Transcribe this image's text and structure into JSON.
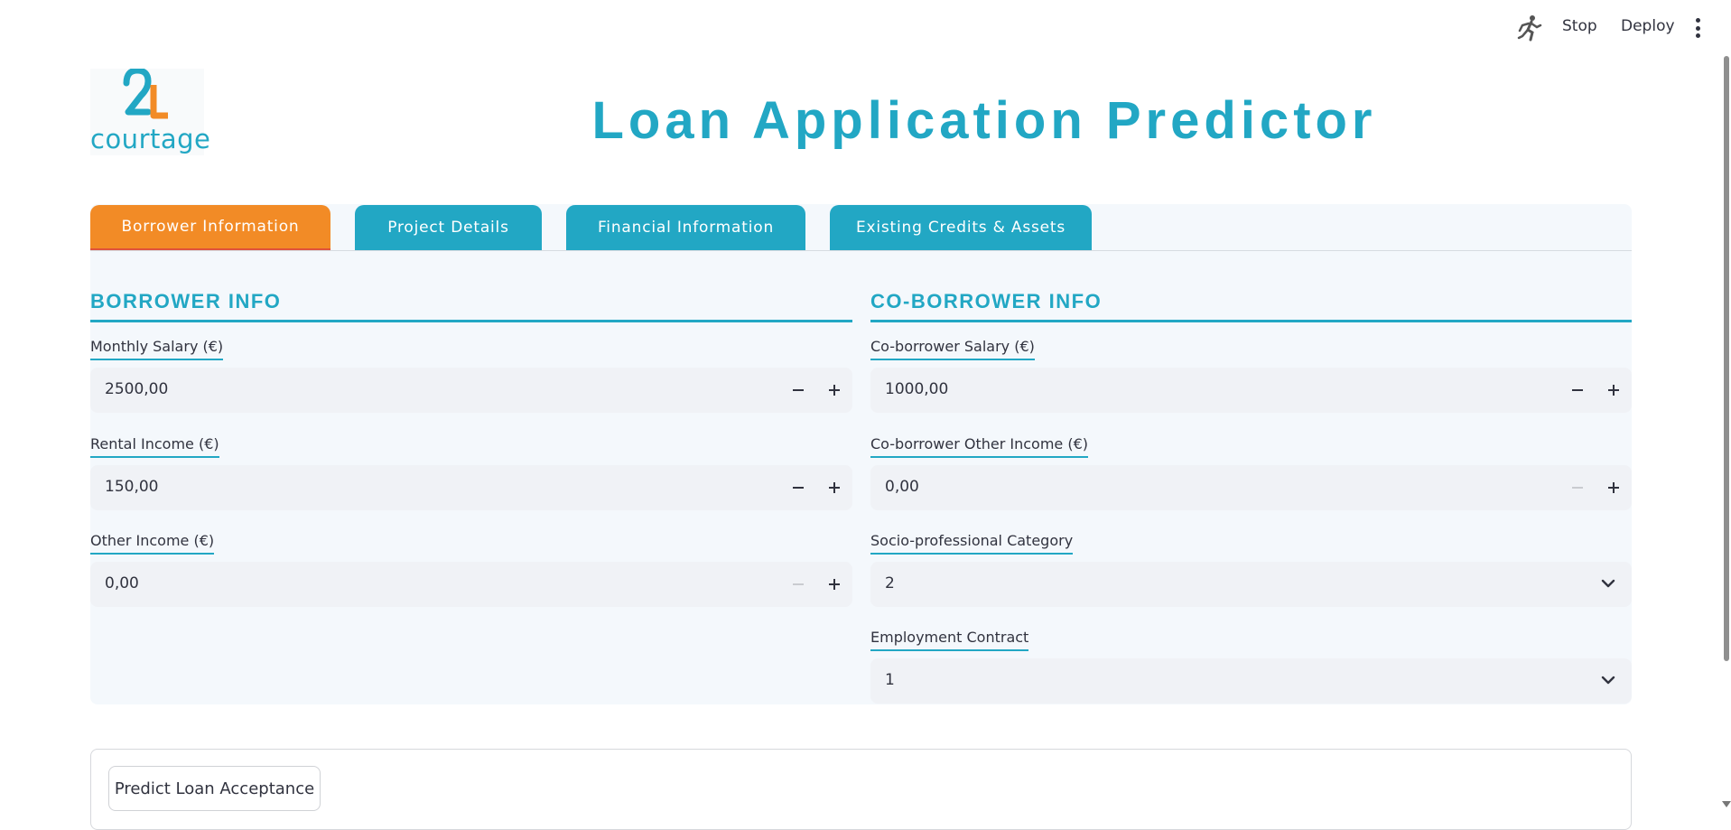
{
  "topbar": {
    "running_icon": "running-man-icon",
    "stop_label": "Stop",
    "deploy_label": "Deploy",
    "menu_icon": "kebab-menu-icon"
  },
  "logo": {
    "number": "2L",
    "text": "courtage"
  },
  "header": {
    "title": "Loan Application Predictor"
  },
  "tabs": [
    {
      "label": "Borrower Information",
      "active": true
    },
    {
      "label": "Project Details",
      "active": false
    },
    {
      "label": "Financial Information",
      "active": false
    },
    {
      "label": "Existing Credits & Assets",
      "active": false
    }
  ],
  "borrower": {
    "heading": "BORROWER INFO",
    "fields": [
      {
        "label": "Monthly Salary (€)",
        "value": "2500,00"
      },
      {
        "label": "Rental Income (€)",
        "value": "150,00"
      },
      {
        "label": "Other Income (€)",
        "value": "0,00"
      }
    ]
  },
  "coborrower": {
    "heading": "CO-BORROWER INFO",
    "fields": [
      {
        "label": "Co-borrower Salary (€)",
        "value": "1000,00"
      },
      {
        "label": "Co-borrower Other Income (€)",
        "value": "0,00"
      }
    ],
    "selects": [
      {
        "label": "Socio-professional Category",
        "value": "2"
      },
      {
        "label": "Employment Contract",
        "value": "1"
      }
    ]
  },
  "actions": {
    "predict_label": "Predict Loan Acceptance"
  },
  "colors": {
    "accent": "#22a7c4",
    "active_tab": "#f28b26",
    "panel": "#f4f8fc",
    "input_bg": "#f0f2f6"
  }
}
